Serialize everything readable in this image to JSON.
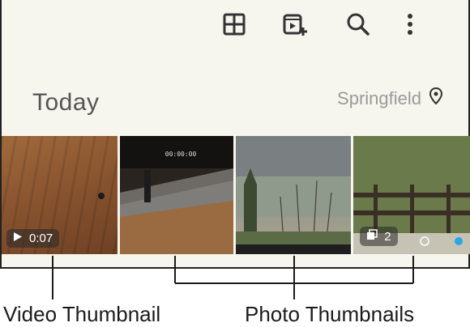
{
  "toolbar": {
    "icons": [
      "grid-view-icon",
      "create-video-icon",
      "search-icon",
      "more-vert-icon"
    ]
  },
  "section": {
    "date_title": "Today",
    "location": "Springfield",
    "location_icon": "location-pin-icon"
  },
  "thumbnails": [
    {
      "kind": "video",
      "duration": "0:07"
    },
    {
      "kind": "photo",
      "overlay_text": "00:00:00"
    },
    {
      "kind": "photo"
    },
    {
      "kind": "photo",
      "stack_count": "2"
    }
  ],
  "callouts": {
    "video_label": "Video Thumbnail",
    "photo_label": "Photo Thumbnails"
  },
  "colors": {
    "screen_bg": "#f6f5ee",
    "text_muted": "#9a9a9a",
    "icon": "#333333",
    "accent_dot": "#2aa5e6"
  }
}
